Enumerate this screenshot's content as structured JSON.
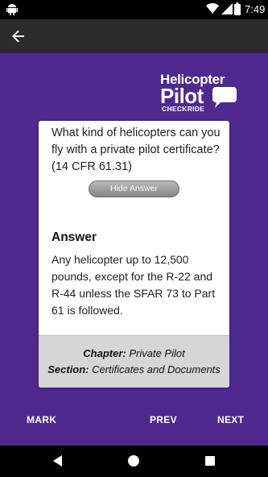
{
  "status_bar": {
    "time": "7:49",
    "icons": [
      "android-debug-icon",
      "wifi-icon",
      "signal-icon",
      "battery-icon"
    ]
  },
  "app_bar": {
    "back_icon": "arrow-back-icon"
  },
  "logo": {
    "line1": "Helicopter",
    "line2": "Pilot",
    "line3": "CHECKRIDE",
    "icon": "speech-bubble-icon"
  },
  "card": {
    "question": "What kind of helicopters can you fly with a private pilot certificate? (14 CFR 61.31)",
    "hide_button_label": "Hide Answer",
    "answer_title": "Answer",
    "answer_text": "Any helicopter up to 12,500 pounds, except for the R-22 and R-44 unless the SFAR 73 to Part 61 is followed.",
    "chapter_label": "Chapter:",
    "chapter_value": "Private Pilot",
    "section_label": "Section:",
    "section_value": "Certificates and Documents"
  },
  "actions": {
    "mark": "MARK",
    "prev": "PREV",
    "next": "NEXT"
  },
  "system_nav": {
    "icons": [
      "nav-back-icon",
      "nav-home-icon",
      "nav-recents-icon"
    ]
  },
  "colors": {
    "background": "#4e2a8e",
    "app_bar": "#2b2b2b",
    "card_footer": "#d6d6d6"
  }
}
